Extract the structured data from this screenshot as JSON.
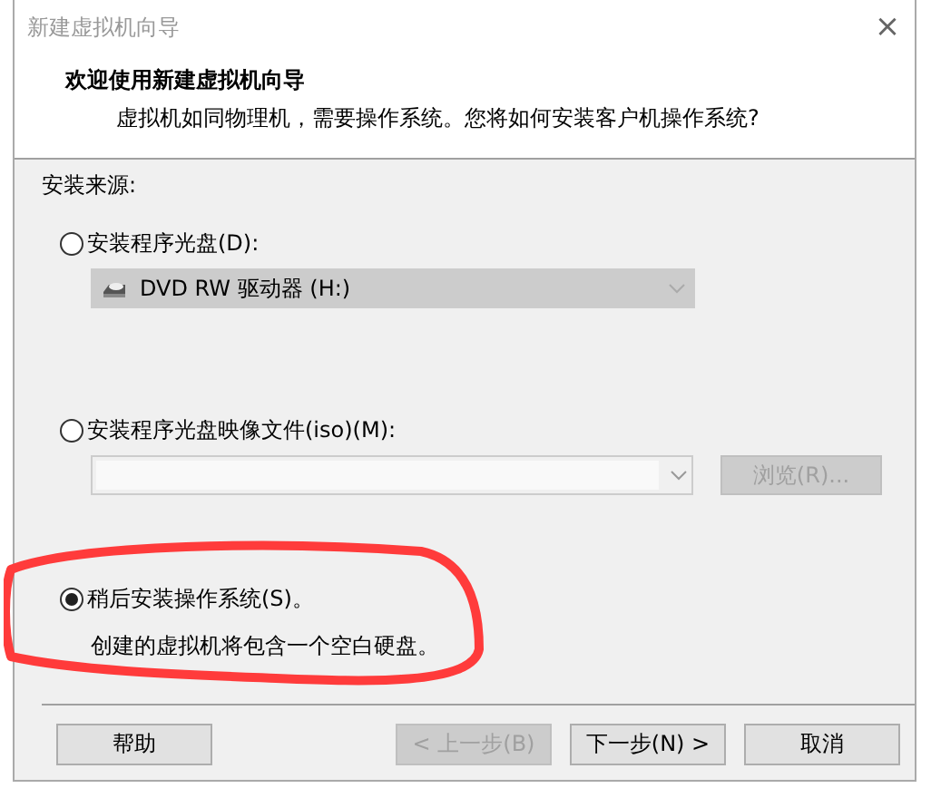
{
  "window": {
    "title": "新建虚拟机向导",
    "close": "×"
  },
  "header": {
    "title": "欢迎使用新建虚拟机向导",
    "subtitle": "虚拟机如同物理机，需要操作系统。您将如何安装客户机操作系统?"
  },
  "source_label": "安装来源:",
  "options": [
    {
      "kind": "disc",
      "label": "安装程序光盘(D):",
      "selected": false,
      "highlighted": false,
      "dropdown": {
        "value": "DVD RW 驱动器 (H:)",
        "disabled": true
      }
    },
    {
      "kind": "image",
      "label": "安装程序光盘映像文件(iso)(M):",
      "selected": false,
      "highlighted": false,
      "combo": {
        "disabled": true
      },
      "browse_button": {
        "label": "浏览(R)...",
        "disabled": true
      }
    },
    {
      "kind": "later",
      "label": "稍后安装操作系统(S)。",
      "selected": true,
      "highlighted": true,
      "note": "创建的虚拟机将包含一个空白硬盘。"
    }
  ],
  "buttons": [
    {
      "label": "帮助",
      "disabled": false
    },
    {
      "label": "< 上一步(B)",
      "disabled": true
    },
    {
      "label": "下一步(N) >",
      "disabled": false
    },
    {
      "label": "取消",
      "disabled": false
    }
  ]
}
